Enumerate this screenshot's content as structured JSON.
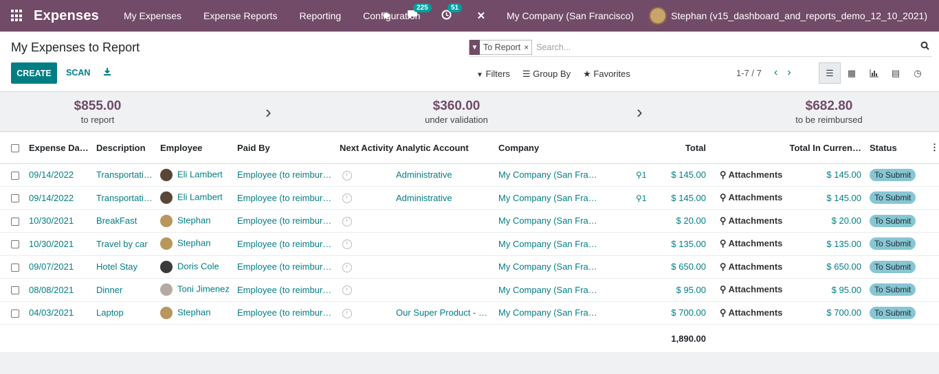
{
  "navbar": {
    "app_name": "Expenses",
    "menu": [
      "My Expenses",
      "Expense Reports",
      "Reporting",
      "Configuration"
    ],
    "messages_count": "225",
    "activities_count": "51",
    "company": "My Company (San Francisco)",
    "user": "Stephan (v15_dashboard_and_reports_demo_12_10_2021)"
  },
  "control": {
    "title": "My Expenses to Report",
    "create_label": "CREATE",
    "scan_label": "SCAN",
    "facet_value": "To Report",
    "search_placeholder": "Search...",
    "filters_label": "Filters",
    "groupby_label": "Group By",
    "favorites_label": "Favorites",
    "pager": "1-7 / 7"
  },
  "summary": [
    {
      "amount": "$855.00",
      "label": "to report"
    },
    {
      "amount": "$360.00",
      "label": "under validation"
    },
    {
      "amount": "$682.80",
      "label": "to be reimbursed"
    }
  ],
  "table": {
    "headers": [
      "Expense Da…",
      "Description",
      "Employee",
      "Paid By",
      "Next Activity",
      "Analytic Account",
      "Company",
      "Total",
      "Total In Curren…",
      "Status"
    ],
    "rows": [
      {
        "date": "09/14/2022",
        "desc": "Transportati…",
        "emp": "Eli Lambert",
        "paid": "Employee (to reimburs…",
        "analytic": "Administrative",
        "company": "My Company (San Fra…",
        "att": "1",
        "total": "$ 145.00",
        "attach": "Attachments",
        "total_cur": "$ 145.00",
        "status": "To Submit"
      },
      {
        "date": "09/14/2022",
        "desc": "Transportati…",
        "emp": "Eli Lambert",
        "paid": "Employee (to reimburs…",
        "analytic": "Administrative",
        "company": "My Company (San Fra…",
        "att": "1",
        "total": "$ 145.00",
        "attach": "Attachments",
        "total_cur": "$ 145.00",
        "status": "To Submit"
      },
      {
        "date": "10/30/2021",
        "desc": "BreakFast",
        "emp": "Stephan",
        "paid": "Employee (to reimburs…",
        "analytic": "",
        "company": "My Company (San Fra…",
        "att": "",
        "total": "$ 20.00",
        "attach": "Attachments",
        "total_cur": "$ 20.00",
        "status": "To Submit"
      },
      {
        "date": "10/30/2021",
        "desc": "Travel by car",
        "emp": "Stephan",
        "paid": "Employee (to reimburs…",
        "analytic": "",
        "company": "My Company (San Fra…",
        "att": "",
        "total": "$ 135.00",
        "attach": "Attachments",
        "total_cur": "$ 135.00",
        "status": "To Submit"
      },
      {
        "date": "09/07/2021",
        "desc": "Hotel Stay",
        "emp": "Doris Cole",
        "paid": "Employee (to reimburs…",
        "analytic": "",
        "company": "My Company (San Fra…",
        "att": "",
        "total": "$ 650.00",
        "attach": "Attachments",
        "total_cur": "$ 650.00",
        "status": "To Submit"
      },
      {
        "date": "08/08/2021",
        "desc": "Dinner",
        "emp": "Toni Jimenez",
        "paid": "Employee (to reimburs…",
        "analytic": "",
        "company": "My Company (San Fra…",
        "att": "",
        "total": "$ 95.00",
        "attach": "Attachments",
        "total_cur": "$ 95.00",
        "status": "To Submit"
      },
      {
        "date": "04/03/2021",
        "desc": "Laptop",
        "emp": "Stephan",
        "paid": "Employee (to reimburs…",
        "analytic": "Our Super Product - De…",
        "company": "My Company (San Fra…",
        "att": "",
        "total": "$ 700.00",
        "attach": "Attachments",
        "total_cur": "$ 700.00",
        "status": "To Submit"
      }
    ],
    "grand_total": "1,890.00"
  },
  "colors": {
    "brand": "#714b67",
    "accent": "#017e84",
    "status_badge": "#87c6d2"
  }
}
